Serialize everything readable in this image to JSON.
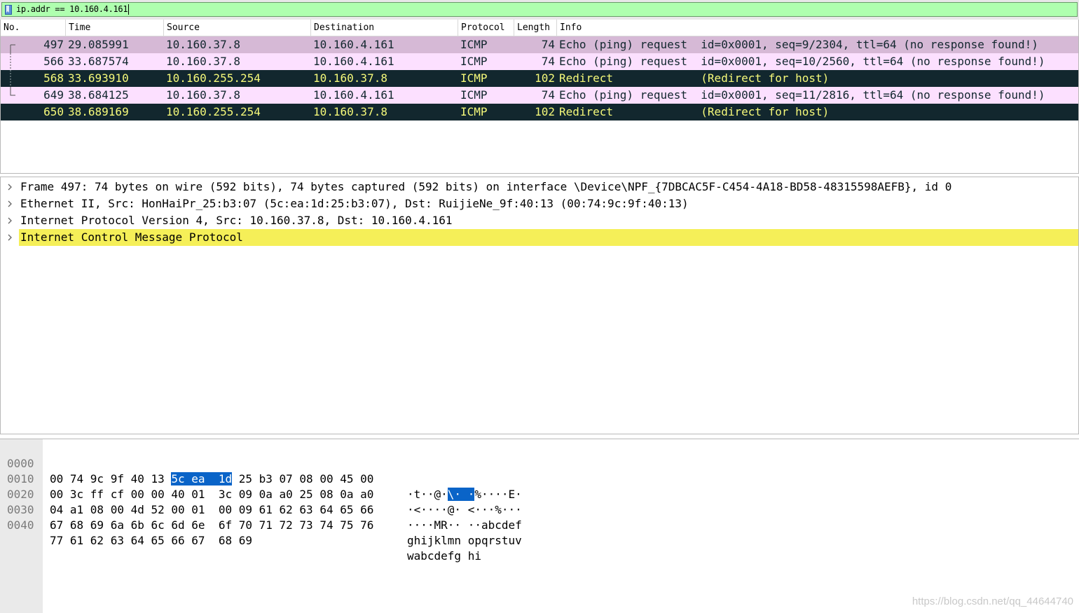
{
  "filter": {
    "value": "ip.addr == 10.160.4.161"
  },
  "columns": [
    "No.",
    "Time",
    "Source",
    "Destination",
    "Protocol",
    "Length",
    "Info"
  ],
  "packets": [
    {
      "no": "497",
      "time": "29.085991",
      "src": "10.160.37.8",
      "dst": "10.160.4.161",
      "proto": "ICMP",
      "len": "74",
      "info": "Echo (ping) request  id=0x0001, seq=9/2304, ttl=64 (no response found!)",
      "style": "echo-selected"
    },
    {
      "no": "566",
      "time": "33.687574",
      "src": "10.160.37.8",
      "dst": "10.160.4.161",
      "proto": "ICMP",
      "len": "74",
      "info": "Echo (ping) request  id=0x0001, seq=10/2560, ttl=64 (no response found!)",
      "style": "echo"
    },
    {
      "no": "568",
      "time": "33.693910",
      "src": "10.160.255.254",
      "dst": "10.160.37.8",
      "proto": "ICMP",
      "len": "102",
      "info": "Redirect             (Redirect for host)",
      "style": "redirect"
    },
    {
      "no": "649",
      "time": "38.684125",
      "src": "10.160.37.8",
      "dst": "10.160.4.161",
      "proto": "ICMP",
      "len": "74",
      "info": "Echo (ping) request  id=0x0001, seq=11/2816, ttl=64 (no response found!)",
      "style": "echo"
    },
    {
      "no": "650",
      "time": "38.689169",
      "src": "10.160.255.254",
      "dst": "10.160.37.8",
      "proto": "ICMP",
      "len": "102",
      "info": "Redirect             (Redirect for host)",
      "style": "redirect"
    }
  ],
  "details": [
    "Frame 497: 74 bytes on wire (592 bits), 74 bytes captured (592 bits) on interface \\Device\\NPF_{7DBCAC5F-C454-4A18-BD58-48315598AEFB}, id 0",
    "Ethernet II, Src: HonHaiPr_25:b3:07 (5c:ea:1d:25:b3:07), Dst: RuijieNe_9f:40:13 (00:74:9c:9f:40:13)",
    "Internet Protocol Version 4, Src: 10.160.37.8, Dst: 10.160.4.161",
    "Internet Control Message Protocol"
  ],
  "bytes": [
    {
      "offset": "0000",
      "hex_pre": "00 74 9c 9f 40 13 ",
      "hex_sel": "5c ea  1d",
      "hex_post": " 25 b3 07 08 00 45 00",
      "ascii_pre": "·t··@·",
      "ascii_sel": "\\· ·",
      "ascii_post": "%····E·"
    },
    {
      "offset": "0010",
      "hex_pre": "00 3c ff cf 00 00 40 01  3c 09 0a a0 25 08 0a a0",
      "hex_sel": "",
      "hex_post": "",
      "ascii_pre": "·<····@· <···%···",
      "ascii_sel": "",
      "ascii_post": ""
    },
    {
      "offset": "0020",
      "hex_pre": "04 a1 08 00 4d 52 00 01  00 09 61 62 63 64 65 66",
      "hex_sel": "",
      "hex_post": "",
      "ascii_pre": "····MR·· ··abcdef",
      "ascii_sel": "",
      "ascii_post": ""
    },
    {
      "offset": "0030",
      "hex_pre": "67 68 69 6a 6b 6c 6d 6e  6f 70 71 72 73 74 75 76",
      "hex_sel": "",
      "hex_post": "",
      "ascii_pre": "ghijklmn opqrstuv",
      "ascii_sel": "",
      "ascii_post": ""
    },
    {
      "offset": "0040",
      "hex_pre": "77 61 62 63 64 65 66 67  68 69",
      "hex_sel": "",
      "hex_post": "",
      "ascii_pre": "wabcdefg hi",
      "ascii_sel": "",
      "ascii_post": ""
    }
  ],
  "watermark": "https://blog.csdn.net/qq_44644740",
  "colors": {
    "filter_bg": "#afffaf",
    "echo_row": "#fce0ff",
    "echo_selected": "#d6b9d6",
    "redirect_row": "#12272e",
    "redirect_text": "#f7f87a",
    "highlight": "#f5ef58",
    "byte_selection": "#0a64c8"
  }
}
